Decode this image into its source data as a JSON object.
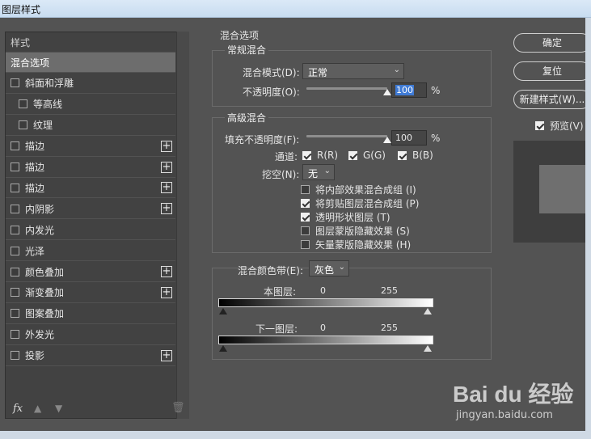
{
  "window": {
    "title": "图层样式"
  },
  "styles_panel": {
    "header": "样式",
    "items": [
      {
        "label": "混合选项",
        "checkbox": false,
        "checked": false,
        "plus": false,
        "active": true,
        "indent": false
      },
      {
        "label": "斜面和浮雕",
        "checkbox": true,
        "checked": false,
        "plus": false,
        "active": false,
        "indent": false
      },
      {
        "label": "等高线",
        "checkbox": true,
        "checked": false,
        "plus": false,
        "active": false,
        "indent": true
      },
      {
        "label": "纹理",
        "checkbox": true,
        "checked": false,
        "plus": false,
        "active": false,
        "indent": true
      },
      {
        "label": "描边",
        "checkbox": true,
        "checked": false,
        "plus": true,
        "active": false,
        "indent": false
      },
      {
        "label": "描边",
        "checkbox": true,
        "checked": false,
        "plus": true,
        "active": false,
        "indent": false
      },
      {
        "label": "描边",
        "checkbox": true,
        "checked": false,
        "plus": true,
        "active": false,
        "indent": false
      },
      {
        "label": "内阴影",
        "checkbox": true,
        "checked": false,
        "plus": true,
        "active": false,
        "indent": false
      },
      {
        "label": "内发光",
        "checkbox": true,
        "checked": false,
        "plus": false,
        "active": false,
        "indent": false
      },
      {
        "label": "光泽",
        "checkbox": true,
        "checked": false,
        "plus": false,
        "active": false,
        "indent": false
      },
      {
        "label": "颜色叠加",
        "checkbox": true,
        "checked": false,
        "plus": true,
        "active": false,
        "indent": false
      },
      {
        "label": "渐变叠加",
        "checkbox": true,
        "checked": false,
        "plus": true,
        "active": false,
        "indent": false
      },
      {
        "label": "图案叠加",
        "checkbox": true,
        "checked": false,
        "plus": false,
        "active": false,
        "indent": false
      },
      {
        "label": "外发光",
        "checkbox": true,
        "checked": false,
        "plus": false,
        "active": false,
        "indent": false
      },
      {
        "label": "投影",
        "checkbox": true,
        "checked": false,
        "plus": true,
        "active": false,
        "indent": false
      }
    ],
    "footer": {
      "fx": "fx"
    }
  },
  "blend_options": {
    "section_title": "混合选项",
    "general": {
      "title": "常规混合",
      "blend_mode_label": "混合模式(D):",
      "blend_mode_value": "正常",
      "opacity_label": "不透明度(O):",
      "opacity_value": "100",
      "opacity_unit": "%",
      "opacity_level": 1.0
    },
    "advanced": {
      "title": "高级混合",
      "fill_opacity_label": "填充不透明度(F):",
      "fill_opacity_value": "100",
      "fill_opacity_unit": "%",
      "fill_opacity_level": 1.0,
      "channels_label": "通道:",
      "channels": [
        {
          "label": "R(R)",
          "checked": true
        },
        {
          "label": "G(G)",
          "checked": true
        },
        {
          "label": "B(B)",
          "checked": true
        }
      ],
      "knockout_label": "挖空(N):",
      "knockout_value": "无",
      "options": [
        {
          "label": "将内部效果混合成组 (I)",
          "checked": false
        },
        {
          "label": "将剪贴图层混合成组 (P)",
          "checked": true
        },
        {
          "label": "透明形状图层 (T)",
          "checked": true
        },
        {
          "label": "图层蒙版隐藏效果 (S)",
          "checked": false
        },
        {
          "label": "矢量蒙版隐藏效果 (H)",
          "checked": false
        }
      ]
    },
    "blend_if": {
      "label": "混合颜色带(E):",
      "value": "灰色",
      "this_layer_label": "本图层:",
      "this_layer_min": "0",
      "this_layer_max": "255",
      "underlying_label": "下一图层:",
      "underlying_min": "0",
      "underlying_max": "255"
    }
  },
  "buttons": {
    "ok": "确定",
    "reset": "复位",
    "new_style": "新建样式(W)...",
    "preview_label": "预览(V)",
    "preview_checked": true
  },
  "watermark": {
    "logo": "Bai du 经验",
    "url": "jingyan.baidu.com"
  }
}
